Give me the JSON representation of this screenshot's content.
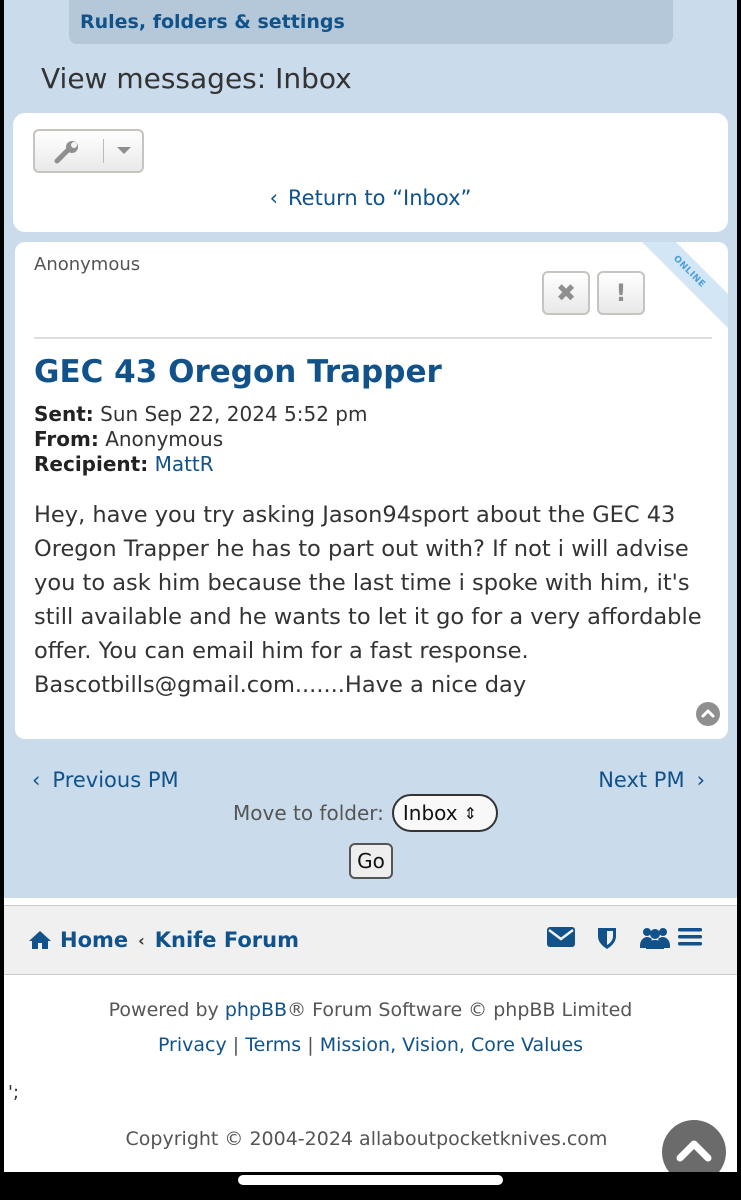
{
  "header": {
    "rules_tab": "Rules, folders & settings",
    "page_title": "View messages: Inbox"
  },
  "toolbar": {
    "return_link": "Return to “Inbox”",
    "tools_icon": "wrench-icon",
    "dropdown_icon": "caret-down-icon"
  },
  "message": {
    "author": "Anonymous",
    "online_badge": "ONLINE",
    "delete_icon": "close-icon",
    "report_icon": "exclamation-icon",
    "subject": "GEC 43 Oregon Trapper",
    "sent_label": "Sent:",
    "sent_value": "Sun Sep 22, 2024 5:52 pm",
    "from_label": "From:",
    "from_value": "Anonymous",
    "recipient_label": "Recipient:",
    "recipient_value": "MattR",
    "body_lines": [
      "Hey, have you try asking Jason94sport about the GEC 43",
      "Oregon Trapper he has to part out with? If not i will advise",
      "you to ask him because the last time i spoke with him, it's",
      "still available and he wants to let it go for a very affordable",
      "offer. You can email him for a fast response.",
      "Bascotbills@gmail.com.......Have a nice day"
    ]
  },
  "pm_nav": {
    "previous": "Previous PM",
    "next": "Next PM",
    "move_label": "Move to folder:",
    "folder_selected": "Inbox",
    "go_label": "Go"
  },
  "navbar": {
    "home": "Home",
    "forum": "Knife Forum",
    "icons": [
      "envelope-icon",
      "shield-icon",
      "users-icon",
      "menu-icon"
    ]
  },
  "footer": {
    "powered_prefix": "Powered by ",
    "powered_link": "phpBB",
    "powered_suffix": "® Forum Software © phpBB Limited",
    "privacy": "Privacy",
    "terms": "Terms",
    "mission": "Mission, Vision, Core Values",
    "separator": "|",
    "stray_text": "';",
    "copyright": "Copyright © 2004-2024 allaboutpocketknives.com"
  },
  "colors": {
    "link": "#105289",
    "header_bg": "#cadceb",
    "tab_bg": "#b4c8da"
  }
}
